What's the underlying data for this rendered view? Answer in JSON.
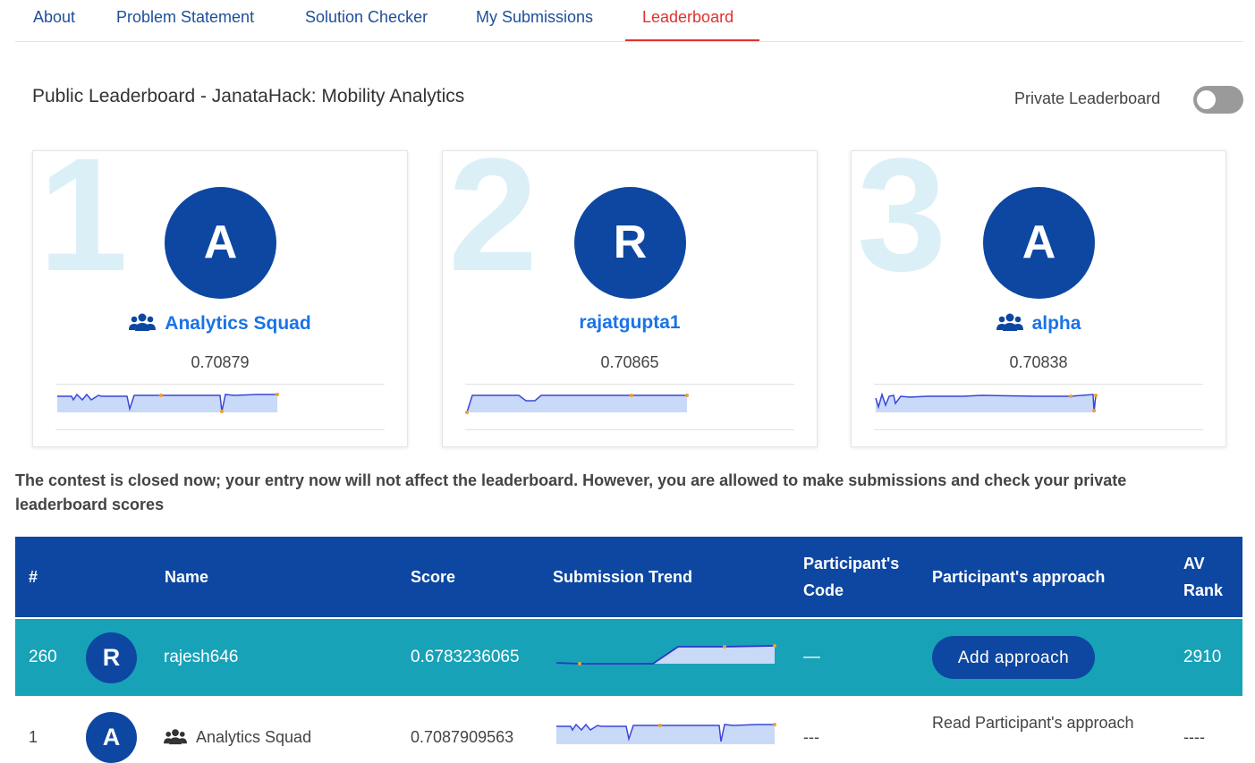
{
  "tabs": [
    {
      "label": "About"
    },
    {
      "label": "Problem Statement"
    },
    {
      "label": "Solution Checker"
    },
    {
      "label": "My Submissions"
    },
    {
      "label": "Leaderboard",
      "active": true
    }
  ],
  "header": {
    "title": "Public Leaderboard - JanataHack: Mobility Analytics",
    "private_toggle_label": "Private Leaderboard",
    "private_toggle_on": false
  },
  "podium": [
    {
      "rank": "1",
      "initial": "A",
      "name": "Analytics Squad",
      "is_team": true,
      "score": "0.70879"
    },
    {
      "rank": "2",
      "initial": "R",
      "name": "rajatgupta1",
      "is_team": false,
      "score": "0.70865"
    },
    {
      "rank": "3",
      "initial": "A",
      "name": "alpha",
      "is_team": true,
      "score": "0.70838"
    }
  ],
  "notice": "The contest is closed now; your entry now will not affect the leaderboard. However, you are allowed to make submissions and check your private leaderboard scores",
  "table": {
    "headers": {
      "rank": "#",
      "name": "Name",
      "score": "Score",
      "trend": "Submission Trend",
      "code_line1": "Participant's",
      "code_line2": "Code",
      "approach": "Participant's approach",
      "av_line1": "AV",
      "av_line2": "Rank"
    },
    "current_user_row": {
      "rank": "260",
      "initial": "R",
      "name": "rajesh646",
      "score": "0.6783236065",
      "code": "—",
      "approach_button": "Add approach",
      "av_rank": "2910"
    },
    "rows": [
      {
        "rank": "1",
        "initial": "A",
        "name": "Analytics Squad",
        "score": "0.7087909563",
        "code": "---",
        "approach": "Read Participant's approach",
        "av_rank": "----"
      }
    ]
  },
  "colors": {
    "primary": "#0d47a1",
    "active_tab": "#e0322f",
    "current_row": "#17a2b8",
    "link": "#1a73e8",
    "rank_watermark": "#dbeff7",
    "spark_fill": "#c9d9f8",
    "spark_line": "#3a46d8",
    "spark_dot": "#f0a030"
  },
  "icons": {
    "team": "team-icon"
  }
}
